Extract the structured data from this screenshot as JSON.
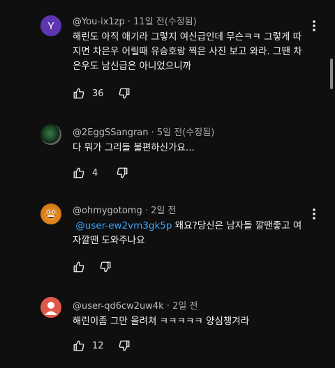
{
  "comments": [
    {
      "avatar_letter": "Y",
      "handle": "@You-ix1zp",
      "time": "11일 전(수정됨)",
      "text_lines": [
        "해린도 아직 애기라 그렇지 여신급인데 무슨ㅋㅋ 그렇게 따",
        "지면 차은우 어릴때 유승호랑 찍은 사진 보고 와라. 그땐 차",
        "은우도 남신급은 아니었으니까"
      ],
      "likes": "36"
    },
    {
      "handle": "@2EggSSangran",
      "time": "5일 전(수정됨)",
      "text_lines": [
        "다 뭐가 그리들 불편하신가요..."
      ],
      "likes": "4"
    },
    {
      "handle": "@ohmygotomg",
      "time": "2일 전",
      "mention": "@user-ew2vm3gk5p",
      "text_first_rest": " 왜요?당신은 남자들 깔땐좋고 여",
      "text_second": "자깔땐 도와주나요",
      "likes": ""
    },
    {
      "handle": "@user-qd6cw2uw4k",
      "time": "2일 전",
      "text_lines": [
        "해린이좀 그만 올려쳐 ㅋㅋㅋㅋㅋ 양심챙겨라"
      ],
      "likes": "12"
    }
  ],
  "icons": {
    "like": "thumbs-up-icon",
    "dislike": "thumbs-down-icon",
    "more": "more-vertical-icon",
    "avatar_default": "person-icon"
  },
  "colors": {
    "background": "#0f0f0f",
    "mention": "#3ea6ff",
    "avatar_y": "#5e35b1",
    "avatar_person": "#e0584a"
  }
}
